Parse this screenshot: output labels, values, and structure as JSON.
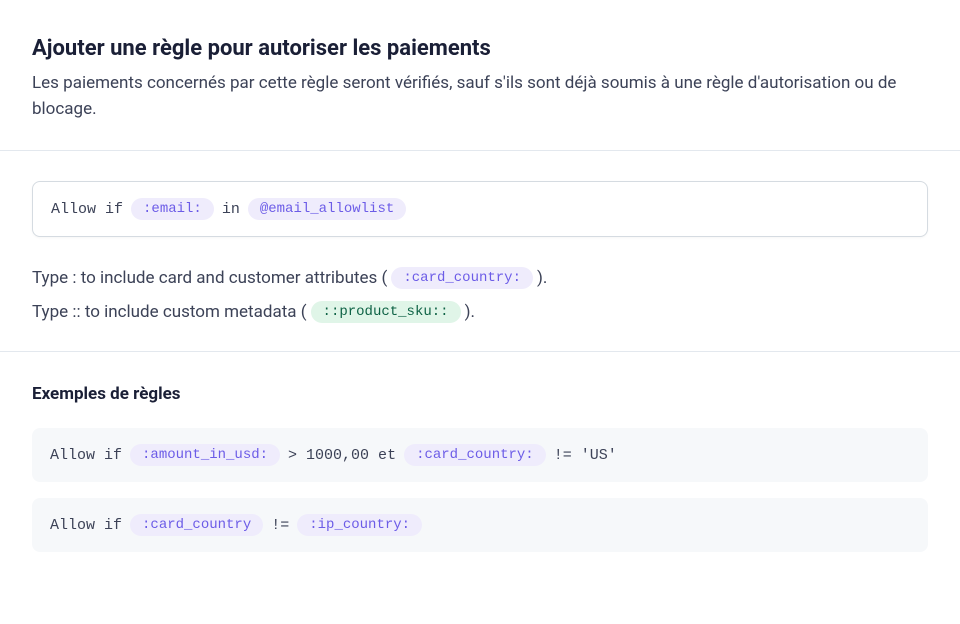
{
  "header": {
    "title": "Ajouter une règle pour autoriser les paiements",
    "description": "Les paiements concernés par cette règle seront vérifiés, sauf s'ils sont déjà soumis à une règle d'autorisation ou de blocage."
  },
  "ruleInput": {
    "allowIf": "Allow if",
    "emailToken": ":email:",
    "inKeyword": "in",
    "listToken": "@email_allowlist"
  },
  "hints": {
    "line1_prefix": "Type : to include card and customer attributes (",
    "line1_token": ":card_country:",
    "line1_suffix": ").",
    "line2_prefix": "Type :: to include custom metadata (",
    "line2_token": "::product_sku::",
    "line2_suffix": ")."
  },
  "examples": {
    "title": "Exemples de règles",
    "ex1": {
      "allowIf": "Allow if",
      "token1": ":amount_in_usd:",
      "op1": "> 1000,00 et",
      "token2": ":card_country:",
      "op2": "!= 'US'"
    },
    "ex2": {
      "allowIf": "Allow if",
      "token1": ":card_country",
      "op1": "!=",
      "token2": ":ip_country:"
    }
  }
}
